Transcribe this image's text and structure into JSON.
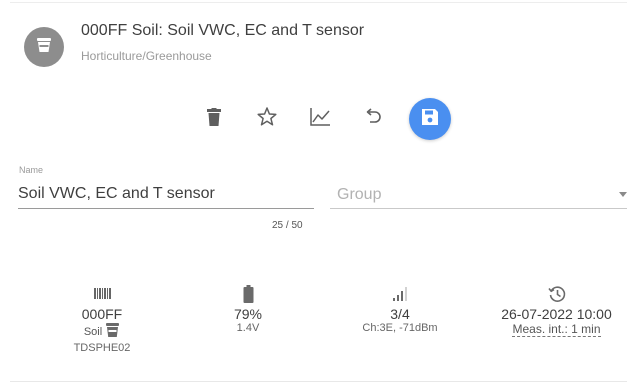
{
  "header": {
    "title": "000FF Soil: Soil VWC, EC and T sensor",
    "subtitle": "Horticulture/Greenhouse",
    "avatar_icon": "soil-pot-icon",
    "avatar_color": "#8d8d8d"
  },
  "toolbar": {
    "buttons": [
      "delete-icon",
      "star-icon",
      "chart-icon",
      "undo-icon",
      "save-icon"
    ],
    "accent_color": "#4a8ff0"
  },
  "name_field": {
    "label": "Name",
    "value": "Soil VWC, EC and T sensor",
    "counter": "25 / 50"
  },
  "group_field": {
    "placeholder": "Group"
  },
  "status": {
    "device_id": "000FF",
    "type": "Soil",
    "model": "TDSPHE02",
    "battery_percent": "79%",
    "battery_voltage": "1.4V",
    "signal": "3/4",
    "signal_detail": "Ch:3E, -71dBm",
    "last_seen": "26-07-2022 10:00",
    "meas_interval": "Meas. int.: 1 min"
  }
}
